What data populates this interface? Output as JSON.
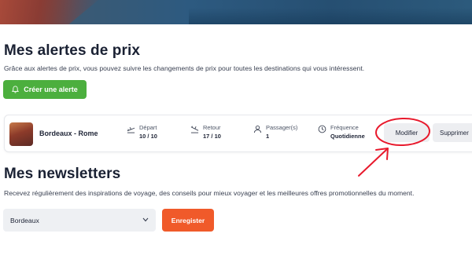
{
  "price_alerts": {
    "title": "Mes alertes de prix",
    "description": "Grâce aux alertes de prix, vous pouvez suivre les changements de prix pour toutes les destinations qui vous intéressent.",
    "create_button": "Créer une alerte",
    "alert": {
      "route": "Bordeaux - Rome",
      "departure": {
        "label": "Départ",
        "value": "10 / 10"
      },
      "return": {
        "label": "Retour",
        "value": "17 / 10"
      },
      "passengers": {
        "label": "Passager(s)",
        "value": "1"
      },
      "frequency": {
        "label": "Fréquence",
        "value": "Quotidienne"
      },
      "modify_button": "Modifier",
      "delete_button": "Supprimer"
    }
  },
  "newsletters": {
    "title": "Mes newsletters",
    "description": "Recevez régulièrement des inspirations de voyage, des conseils pour mieux voyager et les meilleures offres promotionnelles du moment.",
    "city_select": {
      "value": "Bordeaux"
    },
    "save_button": "Enregister"
  },
  "colors": {
    "create_button": "#4caf3e",
    "save_button": "#f05a2a",
    "annotation": "#e8192c"
  },
  "icons": [
    "bell-icon",
    "plane-takeoff-icon",
    "plane-landing-icon",
    "user-icon",
    "clock-icon",
    "chevron-down-icon"
  ]
}
